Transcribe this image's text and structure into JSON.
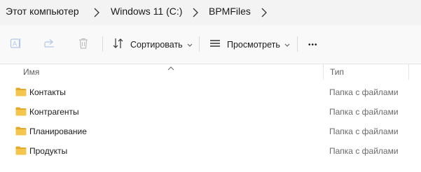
{
  "breadcrumb": {
    "items": [
      {
        "label": "Этот компьютер"
      },
      {
        "label": "Windows 11 (C:)"
      },
      {
        "label": "BPMFiles"
      }
    ]
  },
  "toolbar": {
    "sort_label": "Сортировать",
    "view_label": "Просмотреть",
    "more_label": "•••"
  },
  "columns": {
    "name": "Имя",
    "type": "Тип"
  },
  "rows": [
    {
      "name": "Контакты",
      "type": "Папка с файлами"
    },
    {
      "name": "Контрагенты",
      "type": "Папка с файлами"
    },
    {
      "name": "Планирование",
      "type": "Папка с файлами"
    },
    {
      "name": "Продукты",
      "type": "Папка с файлами"
    }
  ],
  "colors": {
    "folder": "#f4c64e",
    "folder_dark": "#e5a928",
    "accent": "#2f6fde"
  }
}
